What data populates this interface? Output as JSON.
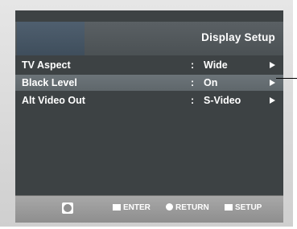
{
  "screen": {
    "title": "Display Setup"
  },
  "menu": {
    "items": [
      {
        "label": "TV Aspect",
        "separator": ":",
        "value": "Wide"
      },
      {
        "label": "Black Level",
        "separator": ":",
        "value": "On",
        "highlighted": true
      },
      {
        "label": "Alt Video Out",
        "separator": ":",
        "value": "S-Video"
      }
    ]
  },
  "footer": {
    "enter_label": "ENTER",
    "return_label": "RETURN",
    "setup_label": "SETUP"
  },
  "colors": {
    "screen_background": "#3d4244",
    "highlight": "#666e72",
    "text": "#ffffff"
  }
}
